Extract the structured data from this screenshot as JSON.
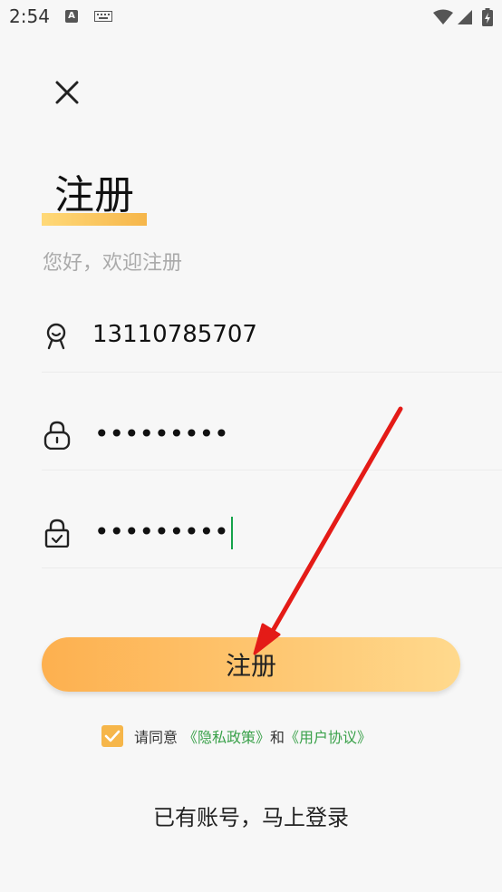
{
  "status_bar": {
    "time": "2:54"
  },
  "page": {
    "title": "注册",
    "subtitle": "您好，欢迎注册"
  },
  "form": {
    "phone_value": "13110785707",
    "password_masked": "•••••••••",
    "confirm_masked": "•••••••••",
    "register_label": "注册"
  },
  "agreement": {
    "checked": true,
    "prefix": "请同意",
    "privacy_link": "《隐私政策》",
    "and": "和",
    "terms_link": "《用户协议》"
  },
  "login_link": "已有账号，马上登录",
  "colors": {
    "accent_start": "#fdb04f",
    "accent_end": "#ffd98d",
    "link_green": "#3aa14a",
    "caret_green": "#16a34a",
    "annotation_arrow": "#e41b17"
  },
  "icons": [
    "close-icon",
    "user-icon",
    "lock-icon",
    "lock-check-icon",
    "checkmark-icon",
    "wifi-icon",
    "signal-icon",
    "battery-icon",
    "keyboard-icon"
  ]
}
